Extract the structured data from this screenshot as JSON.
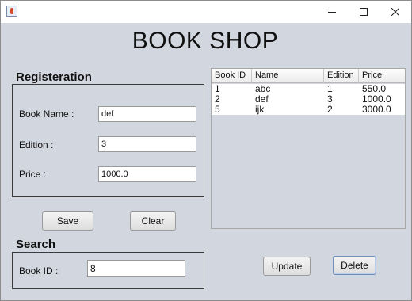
{
  "window": {
    "icon": "java-icon",
    "controls": {
      "minimize": "minimize-icon",
      "maximize": "maximize-icon",
      "close": "close-icon"
    }
  },
  "app_title": "BOOK SHOP",
  "registration": {
    "title": "Registeration",
    "book_name_label": "Book Name :",
    "book_name_value": "def",
    "edition_label": "Edition :",
    "edition_value": "3",
    "price_label": "Price :",
    "price_value": "1000.0"
  },
  "buttons": {
    "save": "Save",
    "clear": "Clear",
    "update": "Update",
    "delete": "Delete"
  },
  "search": {
    "title": "Search",
    "book_id_label": "Book ID :",
    "book_id_value": "8"
  },
  "table": {
    "columns": [
      "Book ID",
      "Name",
      "Edition",
      "Price"
    ],
    "rows": [
      [
        "1",
        "abc",
        "1",
        "550.0"
      ],
      [
        "2",
        "def",
        "3",
        "1000.0"
      ],
      [
        "5",
        "ijk",
        "2",
        "3000.0"
      ]
    ]
  }
}
